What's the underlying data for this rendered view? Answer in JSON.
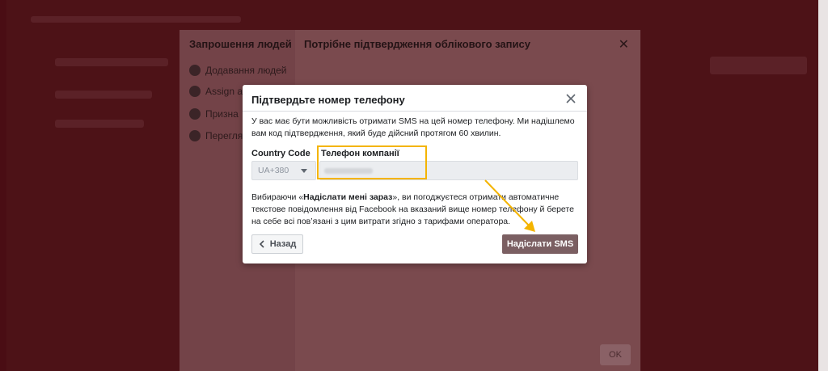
{
  "wizard": {
    "side_title": "Запрошення людей",
    "steps": [
      "Додавання людей",
      "Assign a",
      "Призна",
      "Перегля"
    ],
    "title": "Потрібне підтвердження облікового запису",
    "ok_label": "OK"
  },
  "modal": {
    "title": "Підтвердьте номер телефону",
    "description": "У вас має бути можливість отримати SMS на цей номер телефону. Ми надішлемо вам код підтвердження, який буде дійсний протягом 60 хвилин.",
    "country_label": "Country Code",
    "country_value": "UA+380",
    "phone_label": "Телефон компанії",
    "consent_prefix": "Вибираючи «",
    "consent_bold": "Надіслати мені зараз",
    "consent_suffix": "», ви погоджуєтеся отримати автоматичне текстове повідомлення від Facebook на вказаний вище номер телефону й берете на себе всі пов’язані з цим витрати згідно з тарифами оператора.",
    "back_label": "Назад",
    "send_label": "Надіслати SMS"
  },
  "colors": {
    "overlay": "#4a0d14",
    "primary_button": "#7b5f62",
    "highlight": "#f4b400",
    "annotation_arrow": "#f4b400"
  },
  "icons": {
    "close": "close-icon",
    "back": "chevron-left-icon",
    "dropdown": "caret-down-icon",
    "step": "check-circle-icon"
  }
}
